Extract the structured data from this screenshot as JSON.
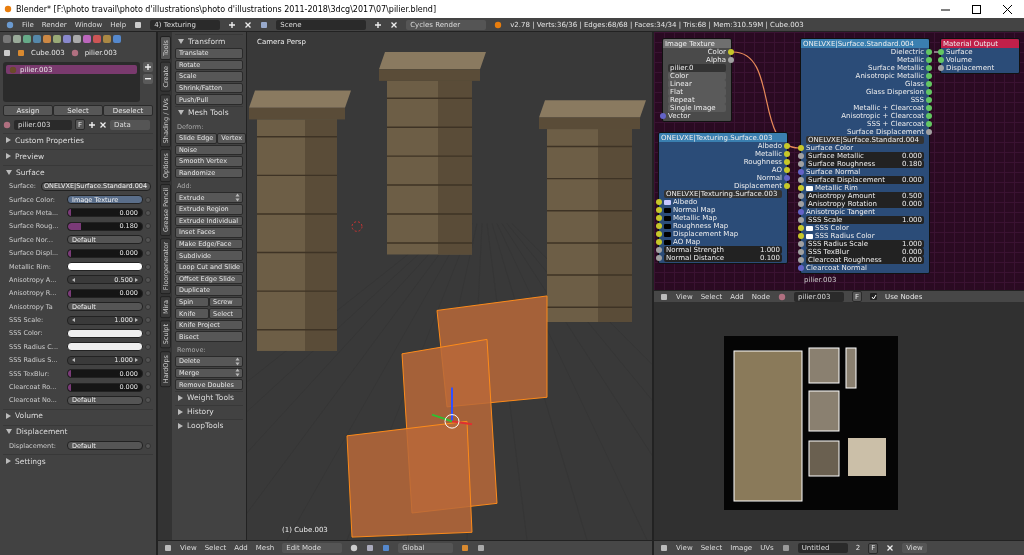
{
  "window": {
    "title": "Blender* [F:\\photo travail\\photo d'illustrations\\photo d'illustrations 2011-2018\\3dcg\\2017\\07\\pilier.blend]"
  },
  "info_bar": {
    "menus": [
      "File",
      "Render",
      "Window",
      "Help"
    ],
    "screen_layout": "4) Texturing",
    "scene": "Scene",
    "engine": "Cycles Render",
    "stats": "v2.78 | Verts:36/36 | Edges:68/68 | Faces:34/34 | Tris:68 | Mem:310.59M | Cube.003"
  },
  "properties": {
    "context_path": [
      "Cube.003",
      "pilier.003"
    ],
    "slots": [
      {
        "name": "pilier.003",
        "selected": true
      }
    ],
    "slot_buttons": [
      "Assign",
      "Select",
      "Deselect"
    ],
    "material": {
      "name": "pilier.003",
      "fake_user": "F",
      "link": "Data"
    },
    "panels": [
      {
        "title": "Custom Properties",
        "expanded": false
      },
      {
        "title": "Preview",
        "expanded": false
      },
      {
        "title": "Surface",
        "expanded": true,
        "rows": [
          {
            "kind": "node",
            "label": "Surface:",
            "value": "ONELVXE|Surface.Standard.004"
          },
          {
            "kind": "linked",
            "label": "Surface Color:",
            "value": "Image Texture"
          },
          {
            "kind": "slider",
            "label": "Surface Meta...",
            "value": "0.000",
            "level": 0
          },
          {
            "kind": "slider",
            "label": "Surface Roug...",
            "value": "0.180",
            "level": 0.18
          },
          {
            "kind": "dropdown",
            "label": "Surface Nor...",
            "value": "Default"
          },
          {
            "kind": "slider",
            "label": "Surface Displ...",
            "value": "0.000",
            "level": 0
          },
          {
            "kind": "color",
            "label": "Metallic Rim:",
            "color": "#ffffff"
          },
          {
            "kind": "number",
            "label": "Anisotropy A...",
            "value": "0.500"
          },
          {
            "kind": "slider",
            "label": "Anisotropy R...",
            "value": "0.000",
            "level": 0
          },
          {
            "kind": "dropdown",
            "label": "Anisotropy Ta",
            "value": "Default"
          },
          {
            "kind": "number",
            "label": "SSS Scale:",
            "value": "1.000"
          },
          {
            "kind": "color",
            "label": "SSS Color:",
            "color": "#eeeeee"
          },
          {
            "kind": "color",
            "label": "SSS Radius C...",
            "color": "#eeeeee"
          },
          {
            "kind": "number",
            "label": "SSS Radius S...",
            "value": "1.000"
          },
          {
            "kind": "slider",
            "label": "SSS TexBlur:",
            "value": "0.000",
            "level": 0
          },
          {
            "kind": "slider",
            "label": "Clearcoat Ro...",
            "value": "0.000",
            "level": 0
          },
          {
            "kind": "dropdown",
            "label": "Clearcoat No...",
            "value": "Default"
          }
        ]
      },
      {
        "title": "Volume",
        "expanded": false
      },
      {
        "title": "Displacement",
        "expanded": true,
        "rows": [
          {
            "kind": "dropdown",
            "label": "Displacement:",
            "value": "Default"
          }
        ]
      },
      {
        "title": "Settings",
        "expanded": false
      }
    ]
  },
  "tool_shelf": {
    "tabs": [
      {
        "label": "Tools",
        "selected": true
      },
      {
        "label": "Create",
        "selected": false
      },
      {
        "label": "Shading / UVs",
        "selected": false
      },
      {
        "label": "Options",
        "selected": false
      },
      {
        "label": "Grease Pencil",
        "selected": false
      },
      {
        "label": "Floorgenerator",
        "selected": false
      },
      {
        "label": "Mira",
        "selected": false
      },
      {
        "label": "Sculpt",
        "selected": false
      },
      {
        "label": "HardOps",
        "selected": false
      }
    ],
    "panels": [
      {
        "title": "Transform",
        "expanded": true,
        "groups": [
          {
            "rows": [
              [
                {
                  "label": "Translate",
                  "kind": "button"
                }
              ],
              [
                {
                  "label": "Rotate",
                  "kind": "button"
                }
              ],
              [
                {
                  "label": "Scale",
                  "kind": "button"
                }
              ],
              [
                {
                  "label": "Shrink/Fatten",
                  "kind": "button"
                }
              ],
              [
                {
                  "label": "Push/Pull",
                  "kind": "button"
                }
              ]
            ]
          }
        ]
      },
      {
        "title": "Mesh Tools",
        "expanded": true,
        "groups": [
          {
            "heading": "Deform:",
            "rows": [
              [
                {
                  "label": "Slide Edge",
                  "kind": "button"
                },
                {
                  "label": "Vertex",
                  "kind": "button"
                }
              ],
              [
                {
                  "label": "Noise",
                  "kind": "button"
                }
              ],
              [
                {
                  "label": "Smooth Vertex",
                  "kind": "button"
                }
              ],
              [
                {
                  "label": "Randomize",
                  "kind": "button"
                }
              ]
            ]
          },
          {
            "heading": "Add:",
            "rows": [
              [
                {
                  "label": "Extrude",
                  "kind": "menu"
                }
              ],
              [
                {
                  "label": "Extrude Region",
                  "kind": "button"
                }
              ],
              [
                {
                  "label": "Extrude Individual",
                  "kind": "button"
                }
              ],
              [
                {
                  "label": "Inset Faces",
                  "kind": "button"
                }
              ],
              [
                {
                  "label": "Make Edge/Face",
                  "kind": "button"
                }
              ],
              [
                {
                  "label": "Subdivide",
                  "kind": "button"
                }
              ],
              [
                {
                  "label": "Loop Cut and Slide",
                  "kind": "button"
                }
              ],
              [
                {
                  "label": "Offset Edge Slide",
                  "kind": "button"
                }
              ],
              [
                {
                  "label": "Duplicate",
                  "kind": "button"
                }
              ],
              [
                {
                  "label": "Spin",
                  "kind": "button"
                },
                {
                  "label": "Screw",
                  "kind": "button"
                }
              ],
              [
                {
                  "label": "Knife",
                  "kind": "button"
                },
                {
                  "label": "Select",
                  "kind": "button"
                }
              ],
              [
                {
                  "label": "Knife Project",
                  "kind": "button"
                }
              ],
              [
                {
                  "label": "Bisect",
                  "kind": "button"
                }
              ]
            ]
          },
          {
            "heading": "Remove:",
            "rows": [
              [
                {
                  "label": "Delete",
                  "kind": "menu"
                }
              ],
              [
                {
                  "label": "Merge",
                  "kind": "menu"
                }
              ],
              [
                {
                  "label": "Remove Doubles",
                  "kind": "button"
                }
              ]
            ]
          }
        ]
      },
      {
        "title": "Weight Tools",
        "expanded": false
      },
      {
        "title": "History",
        "expanded": false
      },
      {
        "title": "LoopTools",
        "expanded": false
      }
    ]
  },
  "viewport": {
    "view_name": "Camera Persp",
    "object_label": "(1) Cube.003",
    "header": {
      "menus": [
        "View",
        "Select",
        "Add",
        "Mesh"
      ],
      "mode": "Edit Mode",
      "orientation": "Global"
    }
  },
  "node_editor": {
    "material_label": "pilier.003",
    "nodes": [
      {
        "title": "Image Texture",
        "color": "#6f6f6f",
        "outputs": [
          {
            "label": "Color",
            "color": "#c7c729"
          },
          {
            "label": "Alpha",
            "color": "#a1a1a1"
          }
        ],
        "field": "pilier.0",
        "inputs": [
          {
            "kind": "menu",
            "label": "Color"
          },
          {
            "kind": "menu",
            "label": "Linear"
          },
          {
            "kind": "menu",
            "label": "Flat"
          },
          {
            "kind": "menu",
            "label": "Repeat"
          },
          {
            "kind": "menu",
            "label": "Single Image"
          },
          {
            "kind": "socket",
            "label": "Vector",
            "color": "#6363c7"
          }
        ]
      },
      {
        "title": "ONELVXE|Texturing.Surface.003",
        "color": "#3a7fb0",
        "outputs": [
          {
            "label": "Albedo",
            "color": "#c7c729"
          },
          {
            "label": "Metallic",
            "color": "#c7c729"
          },
          {
            "label": "Roughness",
            "color": "#c7c729"
          },
          {
            "label": "AO",
            "color": "#c7c729"
          },
          {
            "label": "Normal",
            "color": "#6363c7"
          },
          {
            "label": "Displacement",
            "color": "#c7c729"
          }
        ],
        "field": "ONELVXE|Texturing.Surface.003",
        "inputs": [
          {
            "kind": "swatch",
            "label": "Albedo",
            "color": "#c8c8ff"
          },
          {
            "kind": "swatch",
            "label": "Normal Map",
            "color": "#000000"
          },
          {
            "kind": "swatch",
            "label": "Metallic Map",
            "color": "#000000"
          },
          {
            "kind": "swatch",
            "label": "Roughness Map",
            "color": "#000000"
          },
          {
            "kind": "swatch",
            "label": "Displacement Map",
            "color": "#000000"
          },
          {
            "kind": "swatch",
            "label": "AO Map",
            "color": "#000000"
          },
          {
            "kind": "value",
            "label": "Normal Strength",
            "value": "1.000",
            "color": "#a1a1a1"
          },
          {
            "kind": "value",
            "label": "Normal Distance",
            "value": "0.100",
            "color": "#a1a1a1"
          }
        ]
      },
      {
        "title": "ONELVXE|Surface.Standard.004",
        "color": "#3a7fb0",
        "outputs": [
          {
            "label": "Dielectric",
            "color": "#63c763"
          },
          {
            "label": "Metallic",
            "color": "#63c763"
          },
          {
            "label": "Surface Metallic",
            "color": "#63c763"
          },
          {
            "label": "Anisotropic Metallic",
            "color": "#63c763"
          },
          {
            "label": "Glass",
            "color": "#63c763"
          },
          {
            "label": "Glass Dispersion",
            "color": "#63c763"
          },
          {
            "label": "SSS",
            "color": "#63c763"
          },
          {
            "label": "Metallic + Clearcoat",
            "color": "#63c763"
          },
          {
            "label": "Anisotropic + Clearcoat",
            "color": "#63c763"
          },
          {
            "label": "SSS + Clearcoat",
            "color": "#63c763"
          },
          {
            "label": "Surface Displacement",
            "color": "#a1a1a1"
          }
        ],
        "field": "ONELVXE|Surface.Standard.004",
        "inputs": [
          {
            "kind": "socket",
            "label": "Surface Color",
            "color": "#c7c729"
          },
          {
            "kind": "value",
            "label": "Surface Metallic",
            "value": "0.000",
            "color": "#a1a1a1"
          },
          {
            "kind": "value",
            "label": "Surface Roughness",
            "value": "0.180",
            "color": "#a1a1a1"
          },
          {
            "kind": "socket",
            "label": "Surface Normal",
            "color": "#6363c7"
          },
          {
            "kind": "value",
            "label": "Surface Displacement",
            "value": "0.000",
            "color": "#a1a1a1"
          },
          {
            "kind": "swatch",
            "label": "Metallic Rim",
            "color": "#ffffff"
          },
          {
            "kind": "value",
            "label": "Anisotropy Amount",
            "value": "0.500",
            "color": "#a1a1a1"
          },
          {
            "kind": "value",
            "label": "Anisotropy Rotation",
            "value": "0.000",
            "color": "#a1a1a1"
          },
          {
            "kind": "socket",
            "label": "Anisotropic Tangent",
            "color": "#6363c7"
          },
          {
            "kind": "value",
            "label": "SSS Scale",
            "value": "1.000",
            "color": "#a1a1a1"
          },
          {
            "kind": "swatch",
            "label": "SSS Color",
            "color": "#ffffff"
          },
          {
            "kind": "swatch",
            "label": "SSS Radius Color",
            "color": "#ffffff"
          },
          {
            "kind": "value",
            "label": "SSS Radius Scale",
            "value": "1.000",
            "color": "#a1a1a1"
          },
          {
            "kind": "value",
            "label": "SSS TexBlur",
            "value": "0.000",
            "color": "#a1a1a1"
          },
          {
            "kind": "value",
            "label": "Clearcoat Roughness",
            "value": "0.000",
            "color": "#a1a1a1"
          },
          {
            "kind": "socket",
            "label": "Clearcoat Normal",
            "color": "#6363c7"
          }
        ]
      },
      {
        "title": "Material Output",
        "color": "#c0204a",
        "inputs": [
          {
            "kind": "socket",
            "label": "Surface",
            "color": "#63c763"
          },
          {
            "kind": "socket",
            "label": "Volume",
            "color": "#63c763"
          },
          {
            "kind": "socket",
            "label": "Displacement",
            "color": "#a1a1a1"
          }
        ]
      }
    ],
    "header": {
      "menus": [
        "View",
        "Select",
        "Add",
        "Node"
      ],
      "material": "pilier.003",
      "fake_user": "F",
      "use_nodes": {
        "label": "Use Nodes",
        "checked": true
      }
    }
  },
  "image_editor": {
    "header": {
      "menus": [
        "View",
        "Select",
        "Image",
        "UVs"
      ],
      "image": "Untitled",
      "users": "2",
      "fake_user": "F",
      "display": "View"
    }
  }
}
